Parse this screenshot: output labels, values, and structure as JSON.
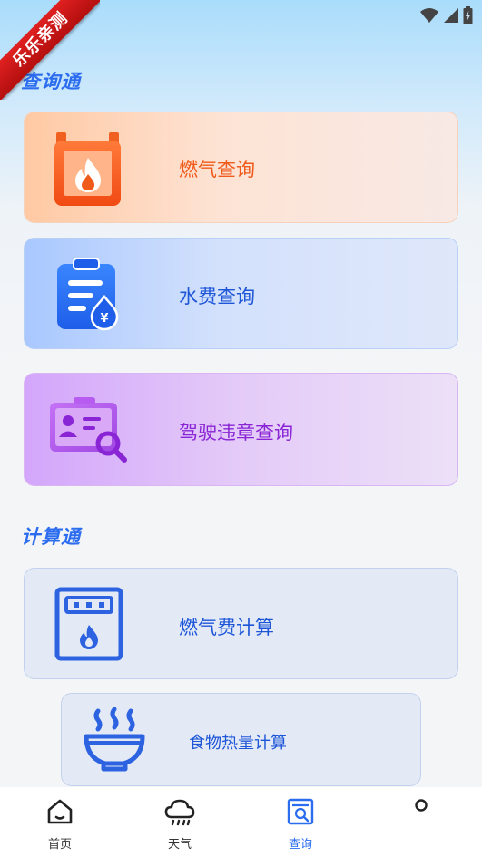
{
  "ribbon": {
    "text": "乐乐亲测"
  },
  "sections": {
    "query": {
      "title": "查询通"
    },
    "calc": {
      "title": "计算通"
    }
  },
  "cards": {
    "gas_query": {
      "label": "燃气查询",
      "icon": "gas-fireplace-icon",
      "color": "#f05a1a"
    },
    "water_query": {
      "label": "水费查询",
      "icon": "water-bill-clipboard-icon",
      "color": "#1e56d8"
    },
    "violation_query": {
      "label": "驾驶违章查询",
      "icon": "id-card-search-icon",
      "color": "#8a25d6"
    },
    "gas_fee_calc": {
      "label": "燃气费计算",
      "icon": "gas-meter-icon",
      "color": "#1e56d8"
    },
    "food_calorie_calc": {
      "label": "食物热量计算",
      "icon": "steaming-bowl-icon",
      "color": "#1e56d8"
    }
  },
  "bottom_nav": {
    "items": [
      {
        "label": "首页",
        "icon": "home-icon",
        "active": false
      },
      {
        "label": "天气",
        "icon": "weather-cloud-rain-icon",
        "active": false
      },
      {
        "label": "查询",
        "icon": "search-document-icon",
        "active": true
      },
      {
        "label": "",
        "icon": "profile-circle-icon",
        "active": false
      }
    ]
  },
  "colors": {
    "accent": "#2c6df0",
    "ribbon": "#d81818"
  }
}
